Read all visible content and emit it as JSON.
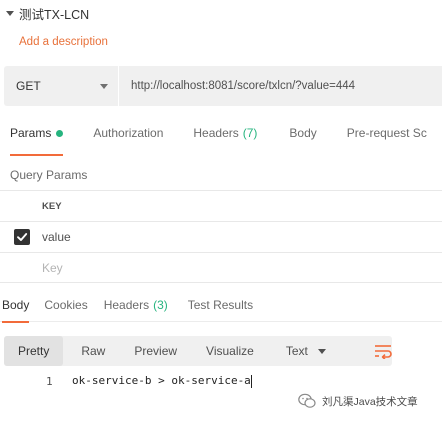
{
  "request": {
    "name": "测试TX-LCN",
    "add_description": "Add a description",
    "method": "GET",
    "url": "http://localhost:8081/score/txlcn/?value=444"
  },
  "request_tabs": [
    {
      "label": "Params",
      "active": true
    },
    {
      "label": "Authorization"
    },
    {
      "label": "Headers",
      "count": "(7)"
    },
    {
      "label": "Body"
    },
    {
      "label": "Pre-request Sc"
    }
  ],
  "query_params": {
    "title": "Query Params",
    "column_key": "KEY",
    "rows": [
      {
        "key": "value",
        "checked": true
      }
    ],
    "new_key_placeholder": "Key"
  },
  "response_tabs": [
    {
      "label": "Body",
      "active": true
    },
    {
      "label": "Cookies"
    },
    {
      "label": "Headers",
      "count": "(3)"
    },
    {
      "label": "Test Results"
    }
  ],
  "view_modes": {
    "pretty": "Pretty",
    "raw": "Raw",
    "preview": "Preview",
    "visualize": "Visualize",
    "format": "Text"
  },
  "response_body": {
    "line_number": "1",
    "text": "ok-service-b > ok-service-a"
  },
  "watermark": {
    "text": "刘凡渠Java技术文章"
  },
  "colors": {
    "accent": "#f26b3a",
    "success": "#26b47f"
  },
  "icons": {
    "collapse": "caret-down-icon",
    "method_dropdown": "chevron-down-icon",
    "checkbox": "checkmark-icon",
    "wrap": "wrap-lines-icon",
    "watermark": "wechat-icon"
  }
}
